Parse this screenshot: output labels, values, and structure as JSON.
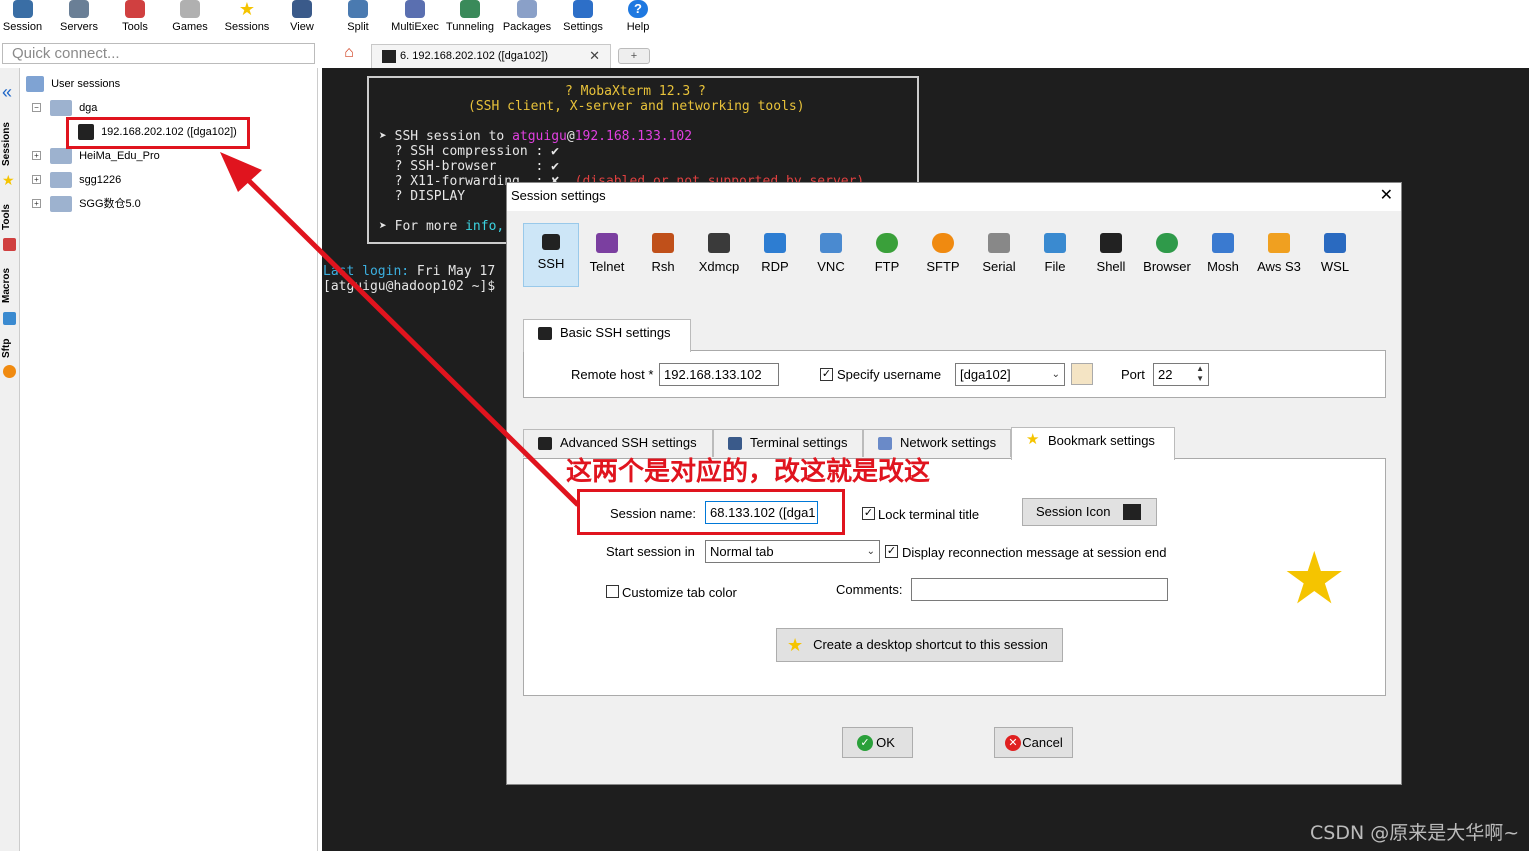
{
  "toolbar": {
    "items": [
      {
        "label": "Session",
        "icon": "session-icon"
      },
      {
        "label": "Servers",
        "icon": "servers-icon"
      },
      {
        "label": "Tools",
        "icon": "tools-icon"
      },
      {
        "label": "Games",
        "icon": "games-icon"
      },
      {
        "label": "Sessions",
        "icon": "sessions-star-icon"
      },
      {
        "label": "View",
        "icon": "view-icon"
      },
      {
        "label": "Split",
        "icon": "split-icon"
      },
      {
        "label": "MultiExec",
        "icon": "multiexec-icon"
      },
      {
        "label": "Tunneling",
        "icon": "tunneling-icon"
      },
      {
        "label": "Packages",
        "icon": "packages-icon"
      },
      {
        "label": "Settings",
        "icon": "settings-icon"
      },
      {
        "label": "Help",
        "icon": "help-icon"
      }
    ]
  },
  "quick_connect": {
    "placeholder": "Quick connect..."
  },
  "tabs": {
    "session_tab": "6. 192.168.202.102 ([dga102])",
    "close": "✕",
    "new_tab": "+"
  },
  "sidebar": {
    "vertical_tabs": [
      "Sessions",
      "Tools",
      "Macros",
      "Sftp"
    ],
    "collapse": "«",
    "tree": {
      "root": "User sessions",
      "items": [
        {
          "label": "dga",
          "expander": "−"
        },
        {
          "label": "192.168.202.102 ([dga102])"
        },
        {
          "label": "HeiMa_Edu_Pro",
          "expander": "+"
        },
        {
          "label": "sgg1226",
          "expander": "+"
        },
        {
          "label": "SGG数仓5.0",
          "expander": "+"
        }
      ]
    }
  },
  "terminal": {
    "banner_title": "? MobaXterm 12.3 ?",
    "banner_subtitle": "(SSH client, X-server and networking tools)",
    "ssh_prefix": "➤ SSH session to ",
    "ssh_user": "atguigu",
    "ssh_at": "@",
    "ssh_host": "192.168.133.102",
    "line_compression": "  ? SSH compression : ✔",
    "line_browser": "  ? SSH-browser     : ✔",
    "line_x11_prefix": "  ? X11-forwarding  : ✘  ",
    "line_x11_disabled": "(disabled or not supported by server)",
    "line_display": "  ? DISPLAY",
    "line_info_prefix": "➤ For more ",
    "line_info_word": "info,",
    "last_login_label": "Last login: ",
    "last_login_value": "Fri May 17",
    "prompt": "[atguigu@hadoop102 ~]$"
  },
  "dialog": {
    "title": "Session settings",
    "close": "✕",
    "protocols": [
      {
        "label": "SSH",
        "icon": "ssh-key-icon",
        "color": "#222222"
      },
      {
        "label": "Telnet",
        "icon": "telnet-icon",
        "color": "#7b3fa0"
      },
      {
        "label": "Rsh",
        "icon": "rsh-icon",
        "color": "#c0501a"
      },
      {
        "label": "Xdmcp",
        "icon": "xdmcp-icon",
        "color": "#3a3a3a"
      },
      {
        "label": "RDP",
        "icon": "rdp-icon",
        "color": "#2d7dd2"
      },
      {
        "label": "VNC",
        "icon": "vnc-icon",
        "color": "#4a8ad0"
      },
      {
        "label": "FTP",
        "icon": "ftp-icon",
        "color": "#3aa03a"
      },
      {
        "label": "SFTP",
        "icon": "sftp-icon",
        "color": "#f08a10"
      },
      {
        "label": "Serial",
        "icon": "serial-icon",
        "color": "#888888"
      },
      {
        "label": "File",
        "icon": "file-icon",
        "color": "#3a8ad0"
      },
      {
        "label": "Shell",
        "icon": "shell-icon",
        "color": "#222222"
      },
      {
        "label": "Browser",
        "icon": "browser-icon",
        "color": "#2f9a4a"
      },
      {
        "label": "Mosh",
        "icon": "mosh-icon",
        "color": "#3a7ad0"
      },
      {
        "label": "Aws S3",
        "icon": "aws-s3-icon",
        "color": "#f0a020"
      },
      {
        "label": "WSL",
        "icon": "wsl-icon",
        "color": "#2a6ac0"
      }
    ],
    "basic_tab": "Basic SSH settings",
    "remote_host_label": "Remote host *",
    "remote_host_value": "192.168.133.102",
    "specify_username_label": "Specify username",
    "username_value": "[dga102]",
    "port_label": "Port",
    "port_value": "22",
    "sub_tabs": [
      "Advanced SSH settings",
      "Terminal settings",
      "Network settings",
      "Bookmark settings"
    ],
    "session_name_label": "Session name:",
    "session_name_value": "68.133.102 ([dga1",
    "lock_title_label": "Lock terminal title",
    "session_icon_label": "Session Icon",
    "start_in_label": "Start session in",
    "start_in_value": "Normal tab",
    "reconnect_label": "Display reconnection message at session end",
    "customize_color_label": "Customize tab color",
    "comments_label": "Comments:",
    "shortcut_label": "Create a desktop shortcut to this session",
    "ok_label": "OK",
    "cancel_label": "Cancel"
  },
  "annotation": "这两个是对应的，改这就是改这",
  "watermark": "CSDN @原来是大华啊~",
  "colors": {
    "accent_red": "#e0141e",
    "terminal_green": "#3cd33c",
    "terminal_magenta": "#e040e0",
    "terminal_yellow": "#e8c23a",
    "star": "#f5c400"
  }
}
